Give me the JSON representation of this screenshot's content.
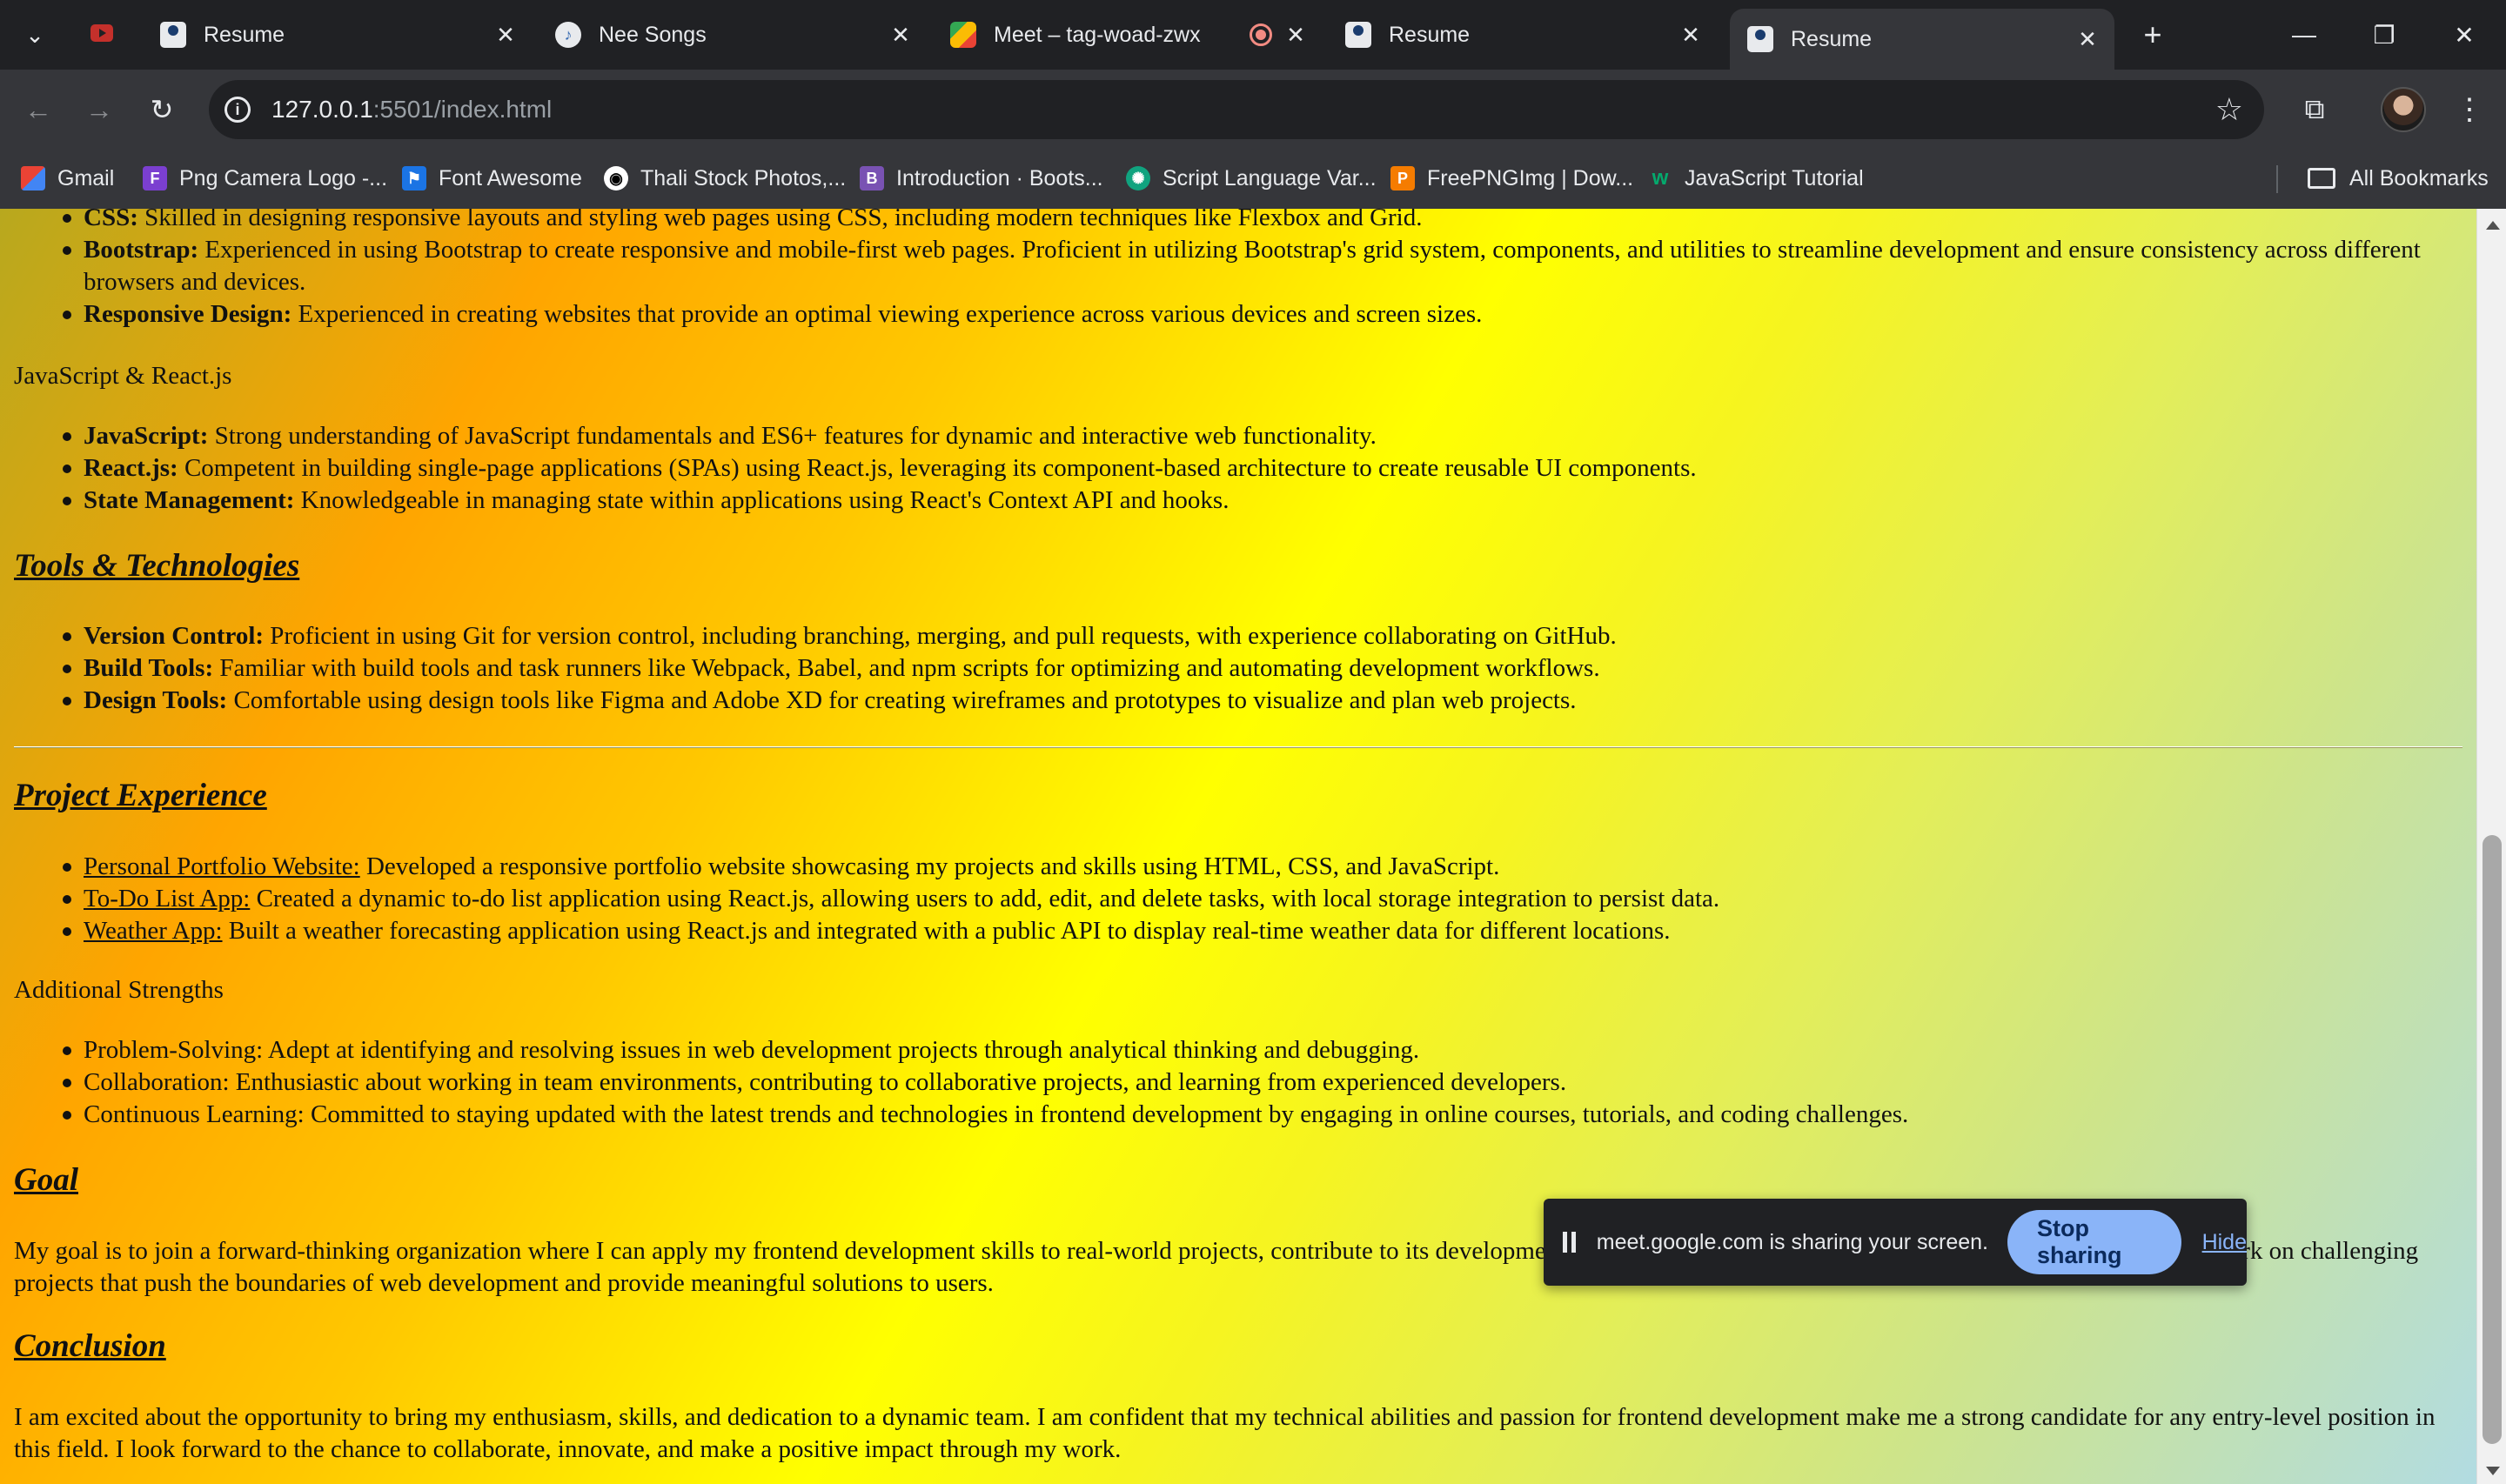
{
  "tabs": [
    {
      "title": "Resume",
      "icon": "person-icon",
      "active": false
    },
    {
      "title": "Nee Songs",
      "icon": "music-icon",
      "active": false
    },
    {
      "title": "Meet – tag-woad-zwx",
      "icon": "meet-icon",
      "active": false
    },
    {
      "title": "Resume",
      "icon": "person-icon",
      "active": false
    },
    {
      "title": "Resume",
      "icon": "person-icon",
      "active": true
    }
  ],
  "address": {
    "host": "127.0.0.1",
    "rest": ":5501/index.html"
  },
  "bookmarks": [
    {
      "label": "Gmail"
    },
    {
      "label": "Png Camera Logo -..."
    },
    {
      "label": "Font Awesome"
    },
    {
      "label": "Thali Stock Photos,..."
    },
    {
      "label": "Introduction · Boots..."
    },
    {
      "label": "Script Language Var..."
    },
    {
      "label": "FreePNGImg | Dow..."
    },
    {
      "label": "JavaScript Tutorial"
    }
  ],
  "all_bookmarks": "All Bookmarks",
  "content": {
    "css_list": [
      {
        "label": "CSS:",
        "text": " Skilled in designing responsive layouts and styling web pages using CSS, including modern techniques like Flexbox and Grid."
      },
      {
        "label": "Bootstrap:",
        "text": " Experienced in using Bootstrap to create responsive and mobile-first web pages. Proficient in utilizing Bootstrap's grid system, components, and utilities to streamline development and ensure consistency across different browsers and devices."
      },
      {
        "label": "Responsive Design:",
        "text": " Experienced in creating websites that provide an optimal viewing experience across various devices and screen sizes."
      }
    ],
    "js_heading": "JavaScript & React.js",
    "js_list": [
      {
        "label": "JavaScript:",
        "text": " Strong understanding of JavaScript fundamentals and ES6+ features for dynamic and interactive web functionality."
      },
      {
        "label": "React.js:",
        "text": " Competent in building single-page applications (SPAs) using React.js, leveraging its component-based architecture to create reusable UI components."
      },
      {
        "label": "State Management:",
        "text": " Knowledgeable in managing state within applications using React's Context API and hooks."
      }
    ],
    "tools_heading": "Tools & Technologies",
    "tools_list": [
      {
        "label": "Version Control:",
        "text": " Proficient in using Git for version control, including branching, merging, and pull requests, with experience collaborating on GitHub."
      },
      {
        "label": "Build Tools:",
        "text": " Familiar with build tools and task runners like Webpack, Babel, and npm scripts for optimizing and automating development workflows."
      },
      {
        "label": "Design Tools:",
        "text": " Comfortable using design tools like Figma and Adobe XD for creating wireframes and prototypes to visualize and plan web projects."
      }
    ],
    "project_heading": "Project Experience",
    "projects": [
      {
        "label": "Personal Portfolio Website:",
        "text": " Developed a responsive portfolio website showcasing my projects and skills using HTML, CSS, and JavaScript."
      },
      {
        "label": "To-Do List App:",
        "text": " Created a dynamic to-do list application using React.js, allowing users to add, edit, and delete tasks, with local storage integration to persist data."
      },
      {
        "label": "Weather App:",
        "text": " Built a weather forecasting application using React.js and integrated with a public API to display real-time weather data for different locations."
      }
    ],
    "strengths_heading": "Additional Strengths",
    "strengths": [
      "Problem-Solving: Adept at identifying and resolving issues in web development projects through analytical thinking and debugging.",
      "Collaboration: Enthusiastic about working in team environments, contributing to collaborative projects, and learning from experienced developers.",
      "Continuous Learning: Committed to staying updated with the latest trends and technologies in frontend development by engaging in online courses, tutorials, and coding challenges."
    ],
    "goal_heading": "Goal",
    "goal_text": "My goal is to join a forward-thinking organization where I can apply my frontend development skills to real-world projects, contribute to its development and growth as a professional in the tech industry. I am eager to work on challenging projects that push the boundaries of web development and provide meaningful solutions to users.",
    "conclusion_heading": "Conclusion",
    "conclusion_text": "I am excited about the opportunity to bring my enthusiasm, skills, and dedication to a dynamic team. I am confident that my technical abilities and passion for frontend development make me a strong candidate for any entry-level position in this field. I look forward to the chance to collaborate, innovate, and make a positive impact through my work."
  },
  "share_banner": {
    "text": "meet.google.com is sharing your screen.",
    "stop_label": "Stop sharing",
    "hide_label": "Hide"
  }
}
